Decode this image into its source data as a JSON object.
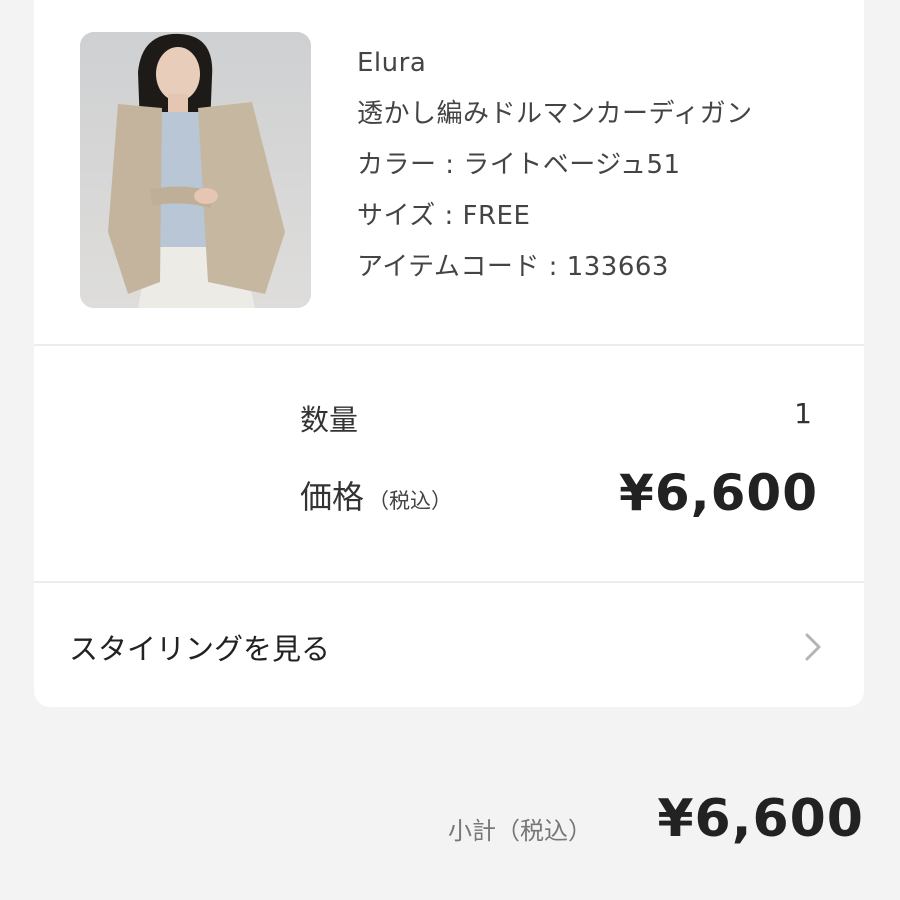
{
  "product": {
    "brand": "Elura",
    "name": "透かし編みドルマンカーディガン",
    "color": "カラー : ライトベージュ51",
    "size": "サイズ : FREE",
    "item_code": "アイテムコード : 133663"
  },
  "summary": {
    "quantity_label": "数量",
    "quantity_value": "1",
    "price_label": "価格",
    "price_tax_note": "（税込）",
    "price_value": "¥6,600"
  },
  "styling": {
    "label": "スタイリングを見る",
    "icon": "chevron-right-icon"
  },
  "subtotal": {
    "label": "小計（税込）",
    "value": "¥6,600"
  },
  "colors": {
    "background": "#f3f3f3",
    "card": "#ffffff",
    "chevron": "#b5b5b5"
  }
}
